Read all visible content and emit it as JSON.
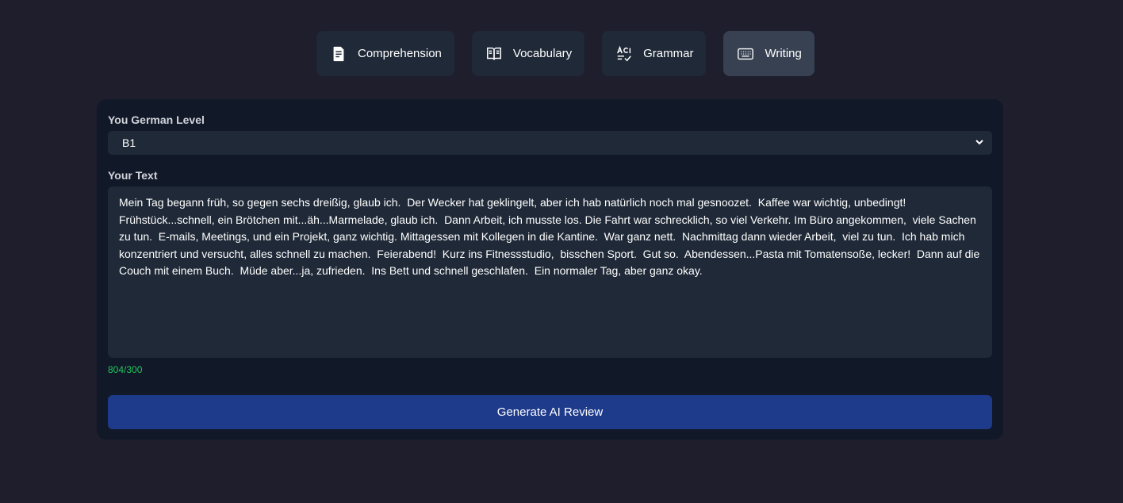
{
  "tabs": [
    {
      "label": "Comprehension",
      "icon": "document-icon",
      "active": false
    },
    {
      "label": "Vocabulary",
      "icon": "book-icon",
      "active": false
    },
    {
      "label": "Grammar",
      "icon": "grammar-check-icon",
      "active": false
    },
    {
      "label": "Writing",
      "icon": "keyboard-icon",
      "active": true
    }
  ],
  "form": {
    "level_label": "You German Level",
    "level_value": "B1",
    "text_label": "Your Text",
    "text_value": "Mein Tag begann früh, so gegen sechs dreißig, glaub ich.  Der Wecker hat geklingelt, aber ich hab natürlich noch mal gesnoozet.  Kaffee war wichtig, unbedingt!  Frühstück...schnell, ein Brötchen mit...äh...Marmelade, glaub ich.  Dann Arbeit, ich musste los. Die Fahrt war schrecklich, so viel Verkehr. Im Büro angekommen,  viele Sachen zu tun.  E-mails, Meetings, und ein Projekt, ganz wichtig. Mittagessen mit Kollegen in die Kantine.  War ganz nett.  Nachmittag dann wieder Arbeit,  viel zu tun.  Ich hab mich konzentriert und versucht, alles schnell zu machen.  Feierabend!  Kurz ins Fitnessstudio,  bisschen Sport.  Gut so.  Abendessen...Pasta mit Tomatensoße, lecker!  Dann auf die Couch mit einem Buch.  Müde aber...ja, zufrieden.  Ins Bett und schnell geschlafen.  Ein normaler Tag, aber ganz okay.",
    "char_count": "804/300",
    "generate_label": "Generate AI Review"
  },
  "colors": {
    "background": "#1e1e2d",
    "card": "#111827",
    "input": "#1f2937",
    "active_tab": "#374151",
    "button": "#1e3a8a",
    "counter": "#22c55e"
  }
}
